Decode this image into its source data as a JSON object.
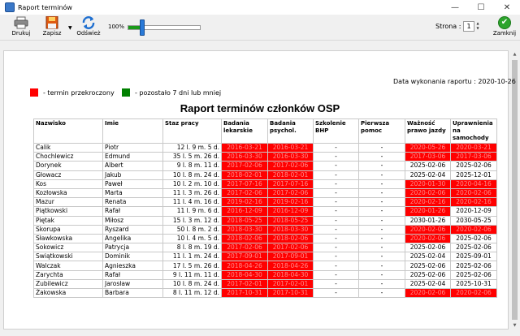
{
  "window": {
    "title": "Raport terminów"
  },
  "toolbar": {
    "print_label": "Drukuj",
    "save_label": "Zapisz",
    "refresh_label": "Odśwież",
    "zoom": "100%",
    "zoom_fraction": 0.2,
    "page_label": "Strona :",
    "page_value": "1",
    "close_label": "Zamknij"
  },
  "report": {
    "date_text": "Data wykonania raportu : 2020-10-26",
    "legend": {
      "expired_label": "- termin przekroczony",
      "expired_color": "#ff0000",
      "soon_label": "- pozostało 7 dni lub mniej",
      "soon_color": "#008000"
    },
    "title": "Raport terminów członków OSP",
    "columns": [
      "Nazwisko",
      "Imie",
      "Staz pracy",
      "Badania lekarskie",
      "Badania psychol.",
      "Szkolenie BHP",
      "Pierwsza pomoc",
      "Ważność prawo jazdy",
      "Uprawnienia na samochody"
    ],
    "rows": [
      [
        "Calik",
        "Piotr",
        "12 l. 9 m. 5 d.",
        "2016-03-21",
        "2016-03-21",
        "-",
        "-",
        "2020-05-26",
        "2020-03-21"
      ],
      [
        "Chochlewicz",
        "Edmund",
        "35 l. 5 m. 26 d.",
        "2016-03-30",
        "2016-03-30",
        "-",
        "-",
        "2017-03-06",
        "2017-03-06"
      ],
      [
        "Dorynek",
        "Albert",
        "9 l. 8 m. 11 d.",
        "2017-02-06",
        "2017-02-06",
        "-",
        "-",
        "2025-02-06",
        "2025-02-06"
      ],
      [
        "Głowacz",
        "Jakub",
        "10 l. 8 m. 24 d.",
        "2018-02-01",
        "2018-02-01",
        "-",
        "-",
        "2025-02-04",
        "2025-12-01"
      ],
      [
        "Kos",
        "Paweł",
        "10 l. 2 m. 10 d.",
        "2017-07-16",
        "2017-07-16",
        "-",
        "-",
        "2020-01-30",
        "2020-04-16"
      ],
      [
        "Kozłowska",
        "Marta",
        "11 l. 3 m. 26 d.",
        "2017-02-06",
        "2017-02-06",
        "-",
        "-",
        "2020-02-06",
        "2020-02-06"
      ],
      [
        "Mazur",
        "Renata",
        "11 l. 4 m. 16 d.",
        "2019-02-16",
        "2019-02-16",
        "-",
        "-",
        "2020-02-16",
        "2020-02-16"
      ],
      [
        "Piątkowski",
        "Rafał",
        "11 l. 9 m. 6 d.",
        "2016-12-09",
        "2016-12-09",
        "-",
        "-",
        "2020-01-26",
        "2020-12-09"
      ],
      [
        "Piętak",
        "Miłosz",
        "15 l. 3 m. 12 d.",
        "2018-05-25",
        "2018-05-25",
        "-",
        "-",
        "2030-01-26",
        "2030-05-25"
      ],
      [
        "Skorupa",
        "Ryszard",
        "50 l. 8 m. 2 d.",
        "2018-03-30",
        "2018-03-30",
        "-",
        "-",
        "2020-02-06",
        "2020-02-06"
      ],
      [
        "Sławkowska",
        "Angelika",
        "10 l. 4 m. 5 d.",
        "2018-02-06",
        "2018-02-06",
        "-",
        "-",
        "2020-02-06",
        "2025-02-06"
      ],
      [
        "Sokowicz",
        "Patrycja",
        "8 l. 8 m. 19 d.",
        "2017-02-06",
        "2017-02-06",
        "-",
        "-",
        "2025-02-06",
        "2025-02-06"
      ],
      [
        "Swiątkowski",
        "Dominik",
        "11 l. 1 m. 24 d.",
        "2017-09-01",
        "2017-09-01",
        "-",
        "-",
        "2025-02-04",
        "2025-09-01"
      ],
      [
        "Walczak",
        "Agnieszka",
        "17 l. 5 m. 26 d.",
        "2018-04-26",
        "2018-04-26",
        "-",
        "-",
        "2025-02-06",
        "2025-02-06"
      ],
      [
        "Zarychta",
        "Rafał",
        "9 l. 11 m. 11 d.",
        "2018-04-30",
        "2018-04-30",
        "-",
        "-",
        "2025-02-06",
        "2025-02-06"
      ],
      [
        "Zubilewicz",
        "Jarosław",
        "10 l. 8 m. 24 d.",
        "2017-02-01",
        "2017-02-01",
        "-",
        "-",
        "2025-02-04",
        "2025-10-31"
      ],
      [
        "Żakowska",
        "Barbara",
        "8 l. 11 m. 12 d.",
        "2017-10-31",
        "2017-10-31",
        "-",
        "-",
        "2020-02-06",
        "2020-02-06"
      ]
    ],
    "row_flags": [
      [
        0,
        0,
        0,
        1,
        1,
        0,
        0,
        1,
        1
      ],
      [
        0,
        0,
        0,
        1,
        1,
        0,
        0,
        1,
        1
      ],
      [
        0,
        0,
        0,
        1,
        1,
        0,
        0,
        0,
        0
      ],
      [
        0,
        0,
        0,
        1,
        1,
        0,
        0,
        0,
        0
      ],
      [
        0,
        0,
        0,
        1,
        1,
        0,
        0,
        1,
        1
      ],
      [
        0,
        0,
        0,
        1,
        1,
        0,
        0,
        1,
        1
      ],
      [
        0,
        0,
        0,
        1,
        1,
        0,
        0,
        1,
        1
      ],
      [
        0,
        0,
        0,
        1,
        1,
        0,
        0,
        1,
        0
      ],
      [
        0,
        0,
        0,
        1,
        1,
        0,
        0,
        0,
        0
      ],
      [
        0,
        0,
        0,
        1,
        1,
        0,
        0,
        1,
        1
      ],
      [
        0,
        0,
        0,
        1,
        1,
        0,
        0,
        1,
        0
      ],
      [
        0,
        0,
        0,
        1,
        1,
        0,
        0,
        0,
        0
      ],
      [
        0,
        0,
        0,
        1,
        1,
        0,
        0,
        0,
        0
      ],
      [
        0,
        0,
        0,
        1,
        1,
        0,
        0,
        0,
        0
      ],
      [
        0,
        0,
        0,
        1,
        1,
        0,
        0,
        0,
        0
      ],
      [
        0,
        0,
        0,
        1,
        1,
        0,
        0,
        0,
        0
      ],
      [
        0,
        0,
        0,
        1,
        1,
        0,
        0,
        1,
        1
      ]
    ]
  }
}
